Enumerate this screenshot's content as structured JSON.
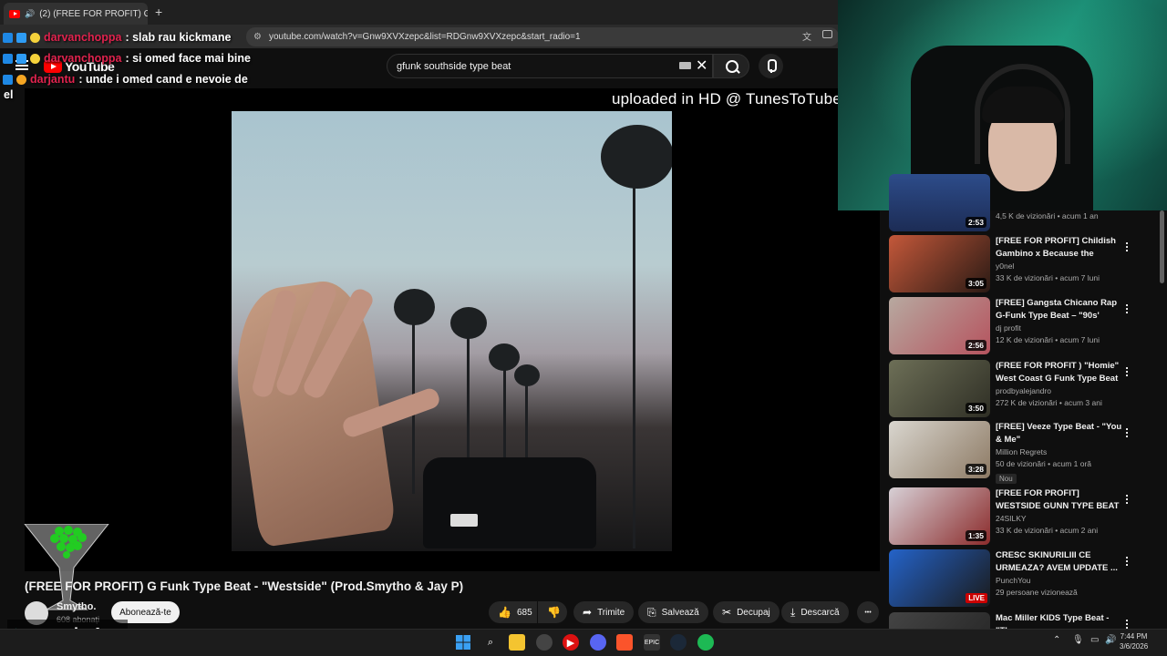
{
  "browser": {
    "tab_title": "(2) (FREE FOR PROFIT) G Funk",
    "new_tab": "+",
    "close": "×",
    "url": "youtube.com/watch?v=Gnw9XVXzepc&list=RDGnw9XVXzepc&start_radio=1"
  },
  "youtube": {
    "logo_text": "YouTube",
    "search_value": "gfunk southside type beat",
    "clear_glyph": "✕"
  },
  "chat": [
    {
      "user": "darvanchoppa",
      "message": ": slab rau kickmane"
    },
    {
      "user": "darvanchoppa",
      "message": ": si omed face mai bine"
    },
    {
      "user": "darjantu",
      "message": ": unde i omed cand e nevoie de"
    }
  ],
  "chat_wrap": "el",
  "player": {
    "watermark": "uploaded in HD @ TunesToTube"
  },
  "video": {
    "title": "(FREE FOR PROFIT) G Funk Type Beat - \"Westside\" (Prod.Smytho & Jay P)",
    "channel": "Smytho.",
    "subscribers": "608 abonați",
    "subscribe_label": "Abonează-te",
    "likes": "685",
    "share_label": "Trimite",
    "save_label": "Salvează",
    "clip_label": "Decupaj",
    "download_label": "Descarcă",
    "more_glyph": "•••"
  },
  "overlay": {
    "tiktok_user": "navashy1"
  },
  "sidebar": {
    "top_partial": {
      "meta": "4,5 K de vizionări • acum 1 an",
      "duration": "2:53"
    },
    "items": [
      {
        "title": "[FREE FOR PROFIT] Childish Gambino x Because the Intern...",
        "channel": "y0nel",
        "meta": "33 K de vizionări • acum 7 luni",
        "duration": "3:05",
        "colors": [
          "#c4583a",
          "#2a1a14"
        ]
      },
      {
        "title": "[FREE] Gangsta Chicano Rap G-Funk Type Beat – \"90s' Brown ...",
        "channel": "dj profit",
        "meta": "12 K de vizionări • acum 7 luni",
        "duration": "2:56",
        "colors": [
          "#b7a9a0",
          "#b5535e"
        ]
      },
      {
        "title": "(FREE FOR PROFIT ) \"Homie\" West Coast G Funk Type Beat ...",
        "channel": "prodbyalejandro",
        "meta": "272 K de vizionări • acum 3 ani",
        "duration": "3:50",
        "colors": [
          "#6d6f57",
          "#2f2f25"
        ]
      },
      {
        "title": "[FREE] Veeze Type Beat - \"You & Me\"",
        "channel": "Million Regrets",
        "meta": "50 de vizionări • acum 1 oră",
        "duration": "3:28",
        "badge": "Nou",
        "colors": [
          "#d9d6cf",
          "#8d7a64"
        ]
      },
      {
        "title": "[FREE FOR PROFIT] WESTSIDE GUNN TYPE BEAT | INTRO",
        "channel": "24SILKY",
        "meta": "33 K de vizionări • acum 2 ani",
        "duration": "1:35",
        "colors": [
          "#d7d0d6",
          "#8b2b2b"
        ]
      },
      {
        "title": "CRESC SKINURILIII CE URMEAZA? AVEM UPDATE ...",
        "channel": "PunchYou",
        "meta": "29 persoane vizionează",
        "duration": "LIVE",
        "colors": [
          "#2463c9",
          "#1a1a1a"
        ]
      },
      {
        "title": "Mac Miller KIDS Type Beat - \"The",
        "channel": "",
        "meta": "",
        "duration": "",
        "colors": [
          "#444",
          "#222"
        ]
      }
    ]
  },
  "taskbar": {
    "time": "7:44 PM",
    "date": "3/6/2026"
  }
}
